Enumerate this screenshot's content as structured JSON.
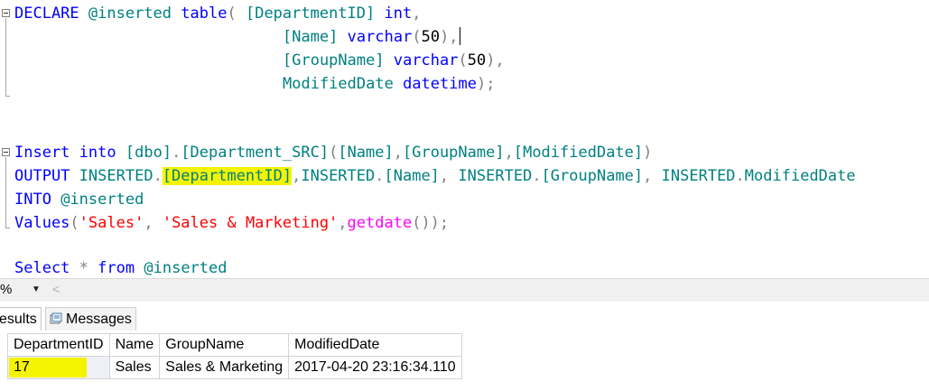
{
  "editor": {
    "line1": {
      "p1": "DECLARE",
      "p2": "@inserted",
      "p3": "table",
      "p4": "(",
      "p5": "[DepartmentID]",
      "p6": "int",
      "p7": ","
    },
    "line2": {
      "p1": "[Name]",
      "p2": "varchar",
      "p3": "(",
      "p4": "50",
      "p5": "),"
    },
    "line3": {
      "p1": "[GroupName]",
      "p2": "varchar",
      "p3": "(",
      "p4": "50",
      "p5": "),"
    },
    "line4": {
      "p1": "ModifiedDate",
      "p2": "datetime",
      "p3": ");"
    },
    "line5": {
      "p1": "Insert",
      "p2": "into",
      "p3": "[dbo]",
      "p4": ".",
      "p5": "[Department_SRC]",
      "p6": "(",
      "p7": "[Name]",
      "p8": ",",
      "p9": "[GroupName]",
      "p10": ",",
      "p11": "[ModifiedDate]",
      "p12": ")"
    },
    "line6": {
      "p1": "OUTPUT",
      "p2": "INSERTED",
      "p3": ".",
      "p4": "[DepartmentID]",
      "p5": ",",
      "p6": "INSERTED",
      "p7": ".",
      "p8": "[Name]",
      "p9": ",",
      "p10": "INSERTED",
      "p11": ".",
      "p12": "[GroupName]",
      "p13": ",",
      "p14": "INSERTED",
      "p15": ".",
      "p16": "ModifiedDate"
    },
    "line7": {
      "p1": "INTO",
      "p2": "@inserted"
    },
    "line8": {
      "p1": "Values",
      "p2": "(",
      "p3": "'Sales'",
      "p4": ",",
      "p5": "'Sales & Marketing'",
      "p6": ",",
      "p7": "getdate",
      "p8": "());"
    },
    "line9": {
      "p1": "Select",
      "p2": "*",
      "p3": "from",
      "p4": "@inserted"
    }
  },
  "zoom": {
    "value": "%"
  },
  "tabs": {
    "results": "esults",
    "messages": "Messages"
  },
  "grid": {
    "columns": [
      "DepartmentID",
      "Name",
      "GroupName",
      "ModifiedDate"
    ],
    "rows": [
      [
        "17",
        "Sales",
        "Sales & Marketing",
        "2017-04-20 23:16:34.110"
      ]
    ]
  },
  "colors": {
    "keyword": "#0000ff",
    "identifier": "#008080",
    "string": "#ff0000",
    "function": "#ff00ff",
    "highlight": "#f4f400"
  }
}
